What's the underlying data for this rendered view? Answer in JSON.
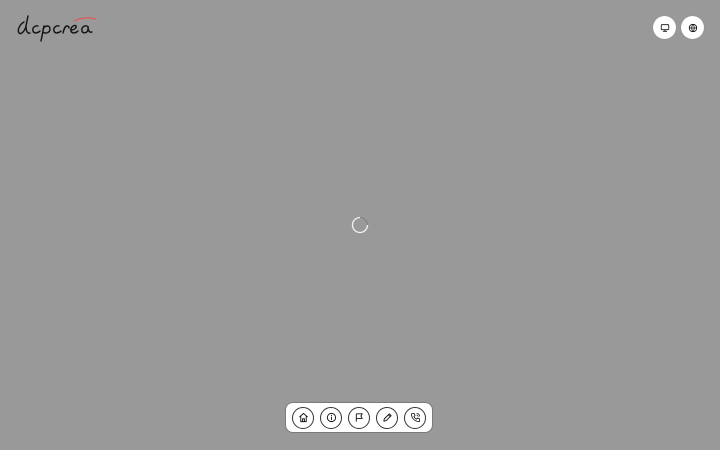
{
  "brand": {
    "logo_text": "dcpcrea",
    "accent_color": "#e05a5a"
  },
  "background_color": "#999999",
  "header": {
    "actions": [
      {
        "name": "desktop-view-button",
        "icon": "monitor-icon"
      },
      {
        "name": "language-button",
        "icon": "globe-icon"
      }
    ]
  },
  "loader": {
    "icon": "loading-spinner-icon"
  },
  "dock": {
    "items": [
      {
        "name": "home-button",
        "icon": "home-icon"
      },
      {
        "name": "info-button",
        "icon": "info-icon"
      },
      {
        "name": "flag-button",
        "icon": "flag-icon"
      },
      {
        "name": "edit-button",
        "icon": "pencil-icon"
      },
      {
        "name": "contact-button",
        "icon": "phone-icon"
      }
    ]
  }
}
